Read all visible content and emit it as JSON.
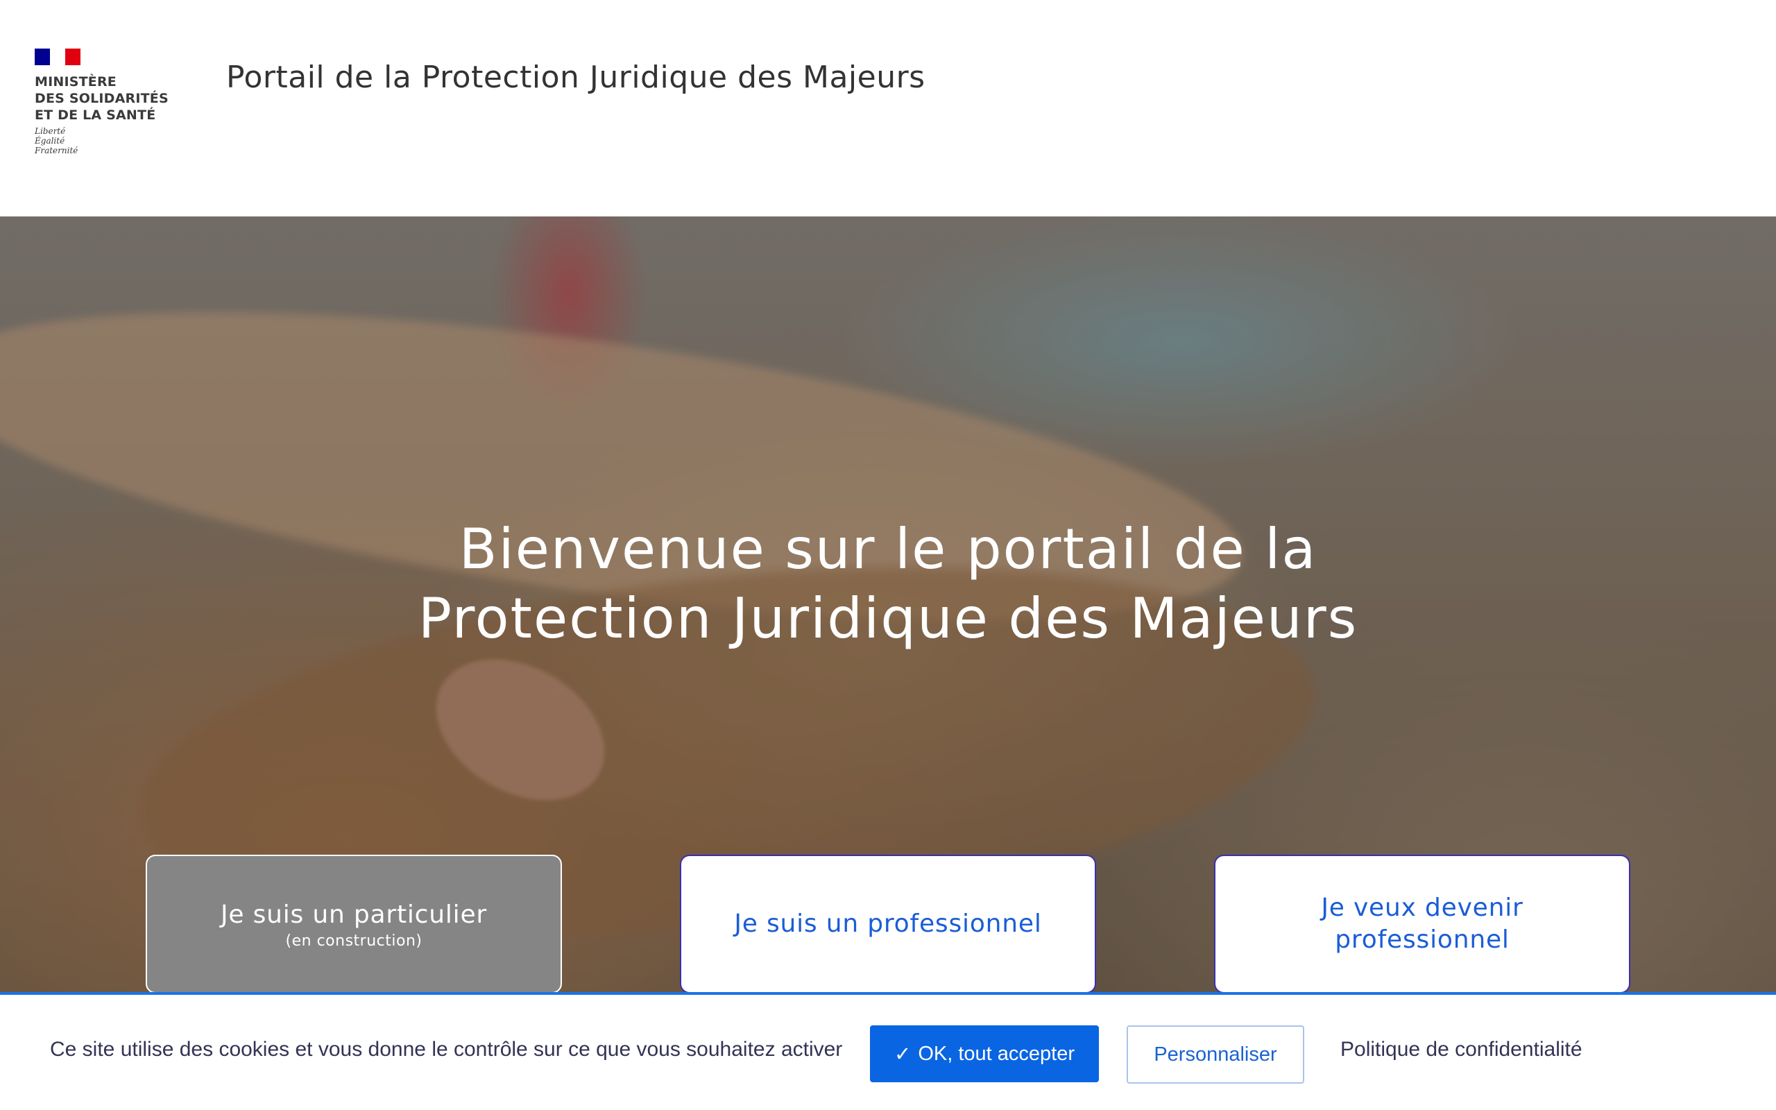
{
  "header": {
    "ministry_lines": [
      "MINISTÈRE",
      "DES SOLIDARITÉS",
      "ET DE LA SANTÉ"
    ],
    "motto_lines": [
      "Liberté",
      "Égalité",
      "Fraternité"
    ],
    "site_title": "Portail de la Protection Juridique des Majeurs"
  },
  "hero": {
    "title_lines": [
      "Bienvenue sur le portail de la",
      "Protection Juridique des Majeurs"
    ]
  },
  "cards": [
    {
      "label": "Je suis un particulier",
      "sublabel": "(en construction)"
    },
    {
      "label": "Je suis un professionnel"
    },
    {
      "label_lines": [
        "Je veux devenir",
        "professionnel"
      ]
    }
  ],
  "cookie": {
    "message": "Ce site utilise des cookies et vous donne le contrôle sur ce que vous souhaitez activer",
    "accept_icon": "✓",
    "accept_label": "OK, tout accepter",
    "customize_label": "Personnaliser",
    "policy_label": "Politique de confidentialité"
  },
  "colors": {
    "accent": "#0a65e3",
    "card_text": "#1a5dd6",
    "card_border": "#3a2fb0",
    "flag_blue": "#000091",
    "flag_red": "#e1000f"
  }
}
